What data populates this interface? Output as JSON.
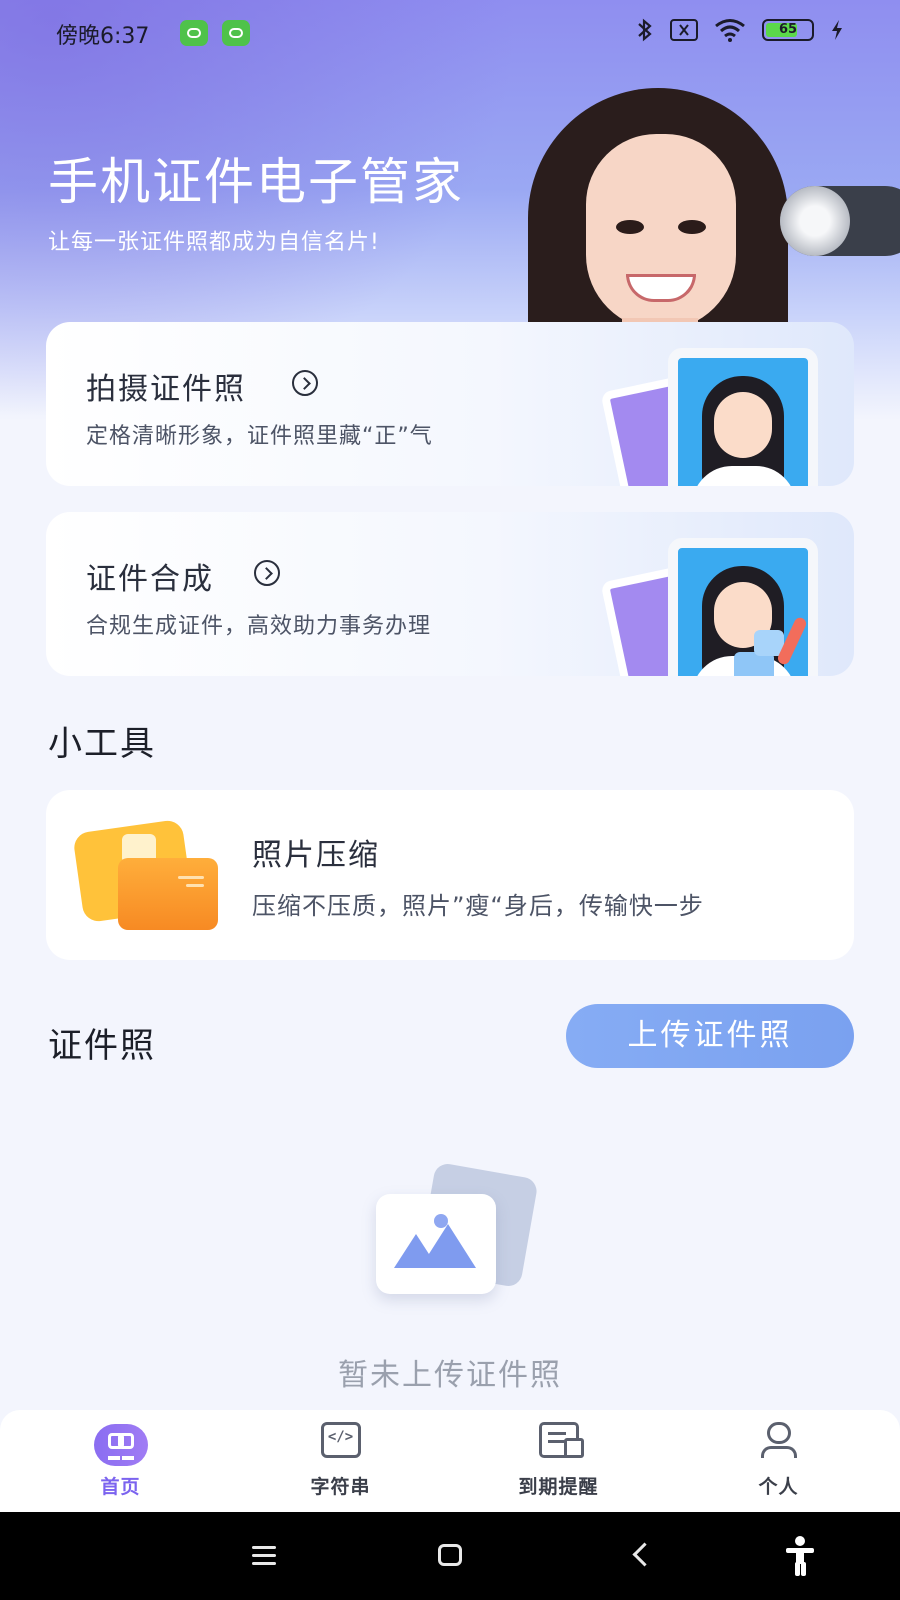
{
  "status_bar": {
    "time": "傍晚6:37",
    "battery": "65",
    "icons": [
      "wechat-badge-icon",
      "wechat-badge-icon",
      "bluetooth-icon",
      "no-sim-icon",
      "wifi-icon",
      "battery-icon",
      "charging-icon"
    ]
  },
  "hero": {
    "title": "手机证件电子管家",
    "subtitle": "让每一张证件照都成为自信名片!"
  },
  "cards": [
    {
      "title": "拍摄证件照",
      "subtitle": "定格清晰形象，证件照里藏“正”气"
    },
    {
      "title": "证件合成",
      "subtitle": "合规生成证件，高效助力事务办理"
    }
  ],
  "tools": {
    "section_title": "小工具",
    "items": [
      {
        "title": "照片压缩",
        "subtitle": "压缩不压质，照片”瘦“身后，传输快一步"
      }
    ]
  },
  "id_photos": {
    "section_title": "证件照",
    "upload_label": "上传证件照",
    "empty_text": "暂未上传证件照"
  },
  "tabs": [
    {
      "label": "首页",
      "icon": "home-grid-icon",
      "active": true
    },
    {
      "label": "字符串",
      "icon": "code-icon",
      "active": false
    },
    {
      "label": "到期提醒",
      "icon": "document-reminder-icon",
      "active": false
    },
    {
      "label": "个人",
      "icon": "user-icon",
      "active": false
    }
  ],
  "colors": {
    "accent": "#7b63ef",
    "upload_button": "#80a7f2",
    "hero_gradient_top": "#8f8ef0"
  }
}
